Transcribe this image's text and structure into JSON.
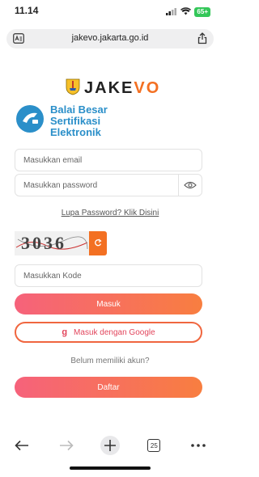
{
  "status": {
    "time": "11.14",
    "battery": "65+"
  },
  "browser": {
    "url": "jakevo.jakarta.go.id",
    "tab_count": "25"
  },
  "brand": {
    "logo_prefix": "JAKE",
    "logo_suffix": "VO",
    "org_name_line1": "Balai Besar",
    "org_name_line2": "Sertifikasi",
    "org_name_line3": "Elektronik"
  },
  "form": {
    "email_placeholder": "Masukkan email",
    "password_placeholder": "Masukkan password",
    "forgot_link": "Lupa Password? Klik Disini",
    "captcha_text": "3036",
    "code_placeholder": "Masukkan Kode",
    "login_button": "Masuk",
    "google_icon_letter": "g",
    "google_button": "Masuk dengan Google",
    "no_account_text": "Belum memiliki akun?",
    "register_button": "Daftar"
  },
  "colors": {
    "accent": "#f37022",
    "brand_blue": "#2b8fc9",
    "button_gradient_start": "#f6627b",
    "button_gradient_end": "#f87e40"
  }
}
